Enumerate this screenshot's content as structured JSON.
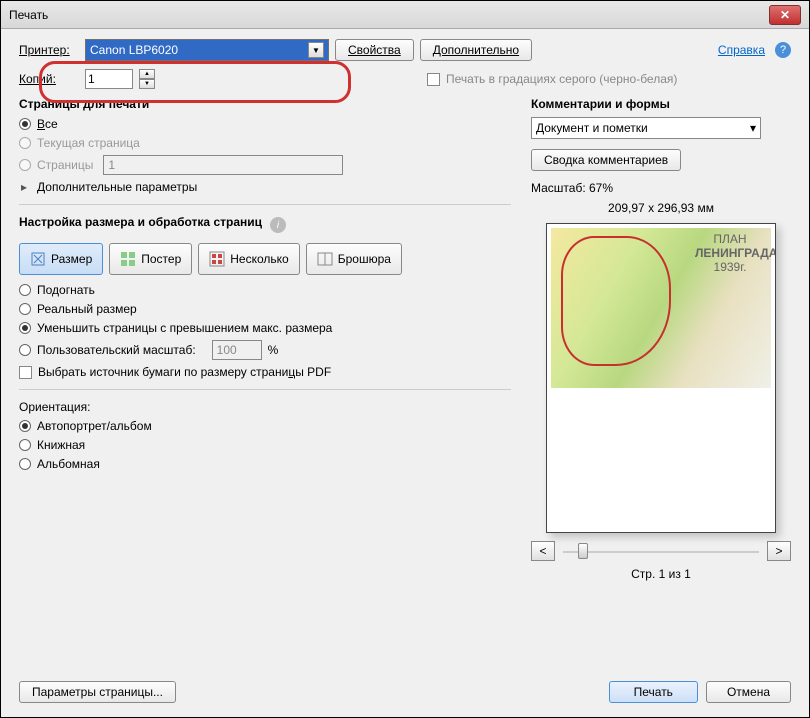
{
  "title": "Печать",
  "printer_label": "Принтер:",
  "printer_value": "Canon LBP6020",
  "properties_btn": "Свойства",
  "advanced_btn": "Дополнительно",
  "help_link": "Справка",
  "copies_label": "Копий:",
  "copies_value": "1",
  "grayscale_label": "Печать в градациях серого (черно-белая)",
  "pages_section": "Страницы для печати",
  "pages_all": "Все",
  "pages_current": "Текущая страница",
  "pages_range_label": "Страницы",
  "pages_range_value": "1",
  "more_options": "Дополнительные параметры",
  "sizing_section": "Настройка размера и обработка страниц",
  "mode_size": "Размер",
  "mode_poster": "Постер",
  "mode_multiple": "Несколько",
  "mode_booklet": "Брошюра",
  "fit": "Подогнать",
  "actual": "Реальный размер",
  "shrink": "Уменьшить страницы с превышением макс. размера",
  "custom_scale": "Пользовательский масштаб:",
  "custom_scale_value": "100",
  "percent": "%",
  "paper_source": "Выбрать источник бумаги по размеру страницы PDF",
  "orientation_label": "Ориентация:",
  "orient_auto": "Автопортрет/альбом",
  "orient_portrait": "Книжная",
  "orient_landscape": "Альбомная",
  "comments_section": "Комментарии и формы",
  "comments_value": "Документ и пометки",
  "summarize_btn": "Сводка комментариев",
  "scale_label": "Масштаб: 67%",
  "dims": "209,97 x 296,93 мм",
  "preview_title1": "ПЛАН",
  "preview_title2": "ЛЕНИНГРАДА",
  "preview_title3": "1939г.",
  "page_indicator": "Стр. 1 из 1",
  "page_setup_btn": "Параметры страницы...",
  "print_btn": "Печать",
  "cancel_btn": "Отмена"
}
